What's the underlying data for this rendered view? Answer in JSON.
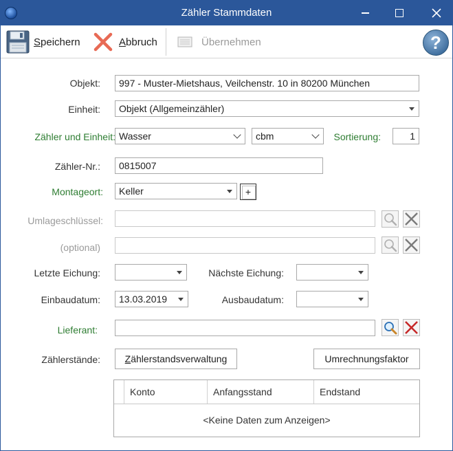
{
  "window": {
    "title": "Zähler Stammdaten"
  },
  "toolbar": {
    "save_label_u": "S",
    "save_label_rest": "peichern",
    "abort_label_u": "A",
    "abort_label_rest": "bbruch",
    "apply_label": "Übernehmen"
  },
  "form": {
    "objekt_label": "Objekt:",
    "objekt_value": "997 - Muster-Mietshaus, Veilchenstr. 10 in 80200 München",
    "einheit_label": "Einheit:",
    "einheit_value": "Objekt (Allgemeinzähler)",
    "zaehler_einheit_label": "Zähler und Einheit:",
    "zaehler_value": "Wasser",
    "einheit_unit_value": "cbm",
    "sortierung_label": "Sortierung:",
    "sortierung_value": "1",
    "zaehler_nr_label": "Zähler-Nr.:",
    "zaehler_nr_value": "0815007",
    "montageort_label": "Montageort:",
    "montageort_value": "Keller",
    "plus_label": "+",
    "umlage_label": "Umlageschlüssel:",
    "umlage_value": "",
    "optional_label": "(optional)",
    "optional_value": "",
    "letzte_eichung_label": "Letzte Eichung:",
    "letzte_eichung_value": "",
    "naechste_eichung_label": "Nächste Eichung:",
    "naechste_eichung_value": "",
    "einbaudatum_label": "Einbaudatum:",
    "einbaudatum_value": "13.03.2019",
    "ausbaudatum_label": "Ausbaudatum:",
    "ausbaudatum_value": "",
    "lieferant_label": "Lieferant:",
    "lieferant_value": "",
    "zaehlerstaende_label": "Zählerstände:",
    "verwaltung_btn_u": "Z",
    "verwaltung_btn_rest": "ählerstandsverwaltung",
    "umrechnung_btn": "Umrechnungsfaktor"
  },
  "grid": {
    "columns": [
      "Konto",
      "Anfangsstand",
      "Endstand"
    ],
    "empty_text": "<Keine Daten zum Anzeigen>"
  }
}
